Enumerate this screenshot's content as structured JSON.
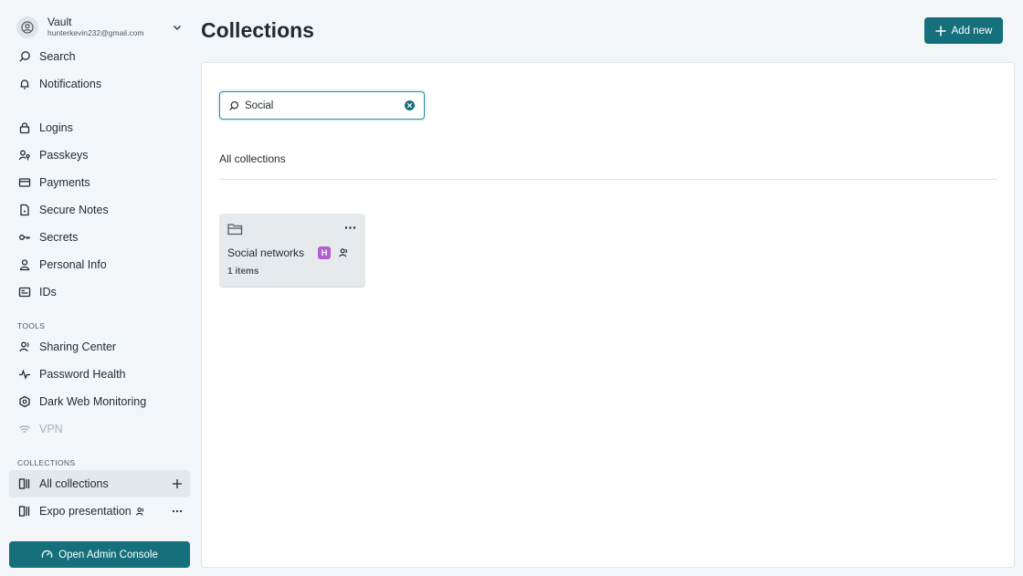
{
  "account": {
    "name": "Vault",
    "email": "hunterkevin232@gmail.com"
  },
  "nav": {
    "top": [
      {
        "label": "Search",
        "icon": "search-icon"
      },
      {
        "label": "Notifications",
        "icon": "bell-icon"
      }
    ],
    "vault": [
      {
        "label": "Logins",
        "icon": "lock-icon"
      },
      {
        "label": "Passkeys",
        "icon": "passkey-icon"
      },
      {
        "label": "Payments",
        "icon": "card-icon"
      },
      {
        "label": "Secure Notes",
        "icon": "note-icon"
      },
      {
        "label": "Secrets",
        "icon": "key-icon"
      },
      {
        "label": "Personal Info",
        "icon": "person-icon"
      },
      {
        "label": "IDs",
        "icon": "id-card-icon"
      }
    ],
    "tools_label": "TOOLS",
    "tools": [
      {
        "label": "Sharing Center",
        "icon": "sharing-icon"
      },
      {
        "label": "Password Health",
        "icon": "pulse-icon"
      },
      {
        "label": "Dark Web Monitoring",
        "icon": "radar-icon"
      },
      {
        "label": "VPN",
        "icon": "wifi-icon"
      }
    ],
    "collections_label": "COLLECTIONS",
    "collections": [
      {
        "label": "All collections",
        "icon": "collection-icon"
      },
      {
        "label": "Expo presentation",
        "icon": "collection-icon"
      }
    ],
    "admin_button": "Open Admin Console"
  },
  "main": {
    "title": "Collections",
    "add_button": "Add new",
    "search": {
      "value": "Social"
    },
    "subheading": "All collections",
    "cards": [
      {
        "name": "Social networks",
        "badge": "H",
        "count": "1 items"
      }
    ]
  },
  "colors": {
    "accent": "#15707c",
    "badge": "#b25fd1"
  }
}
